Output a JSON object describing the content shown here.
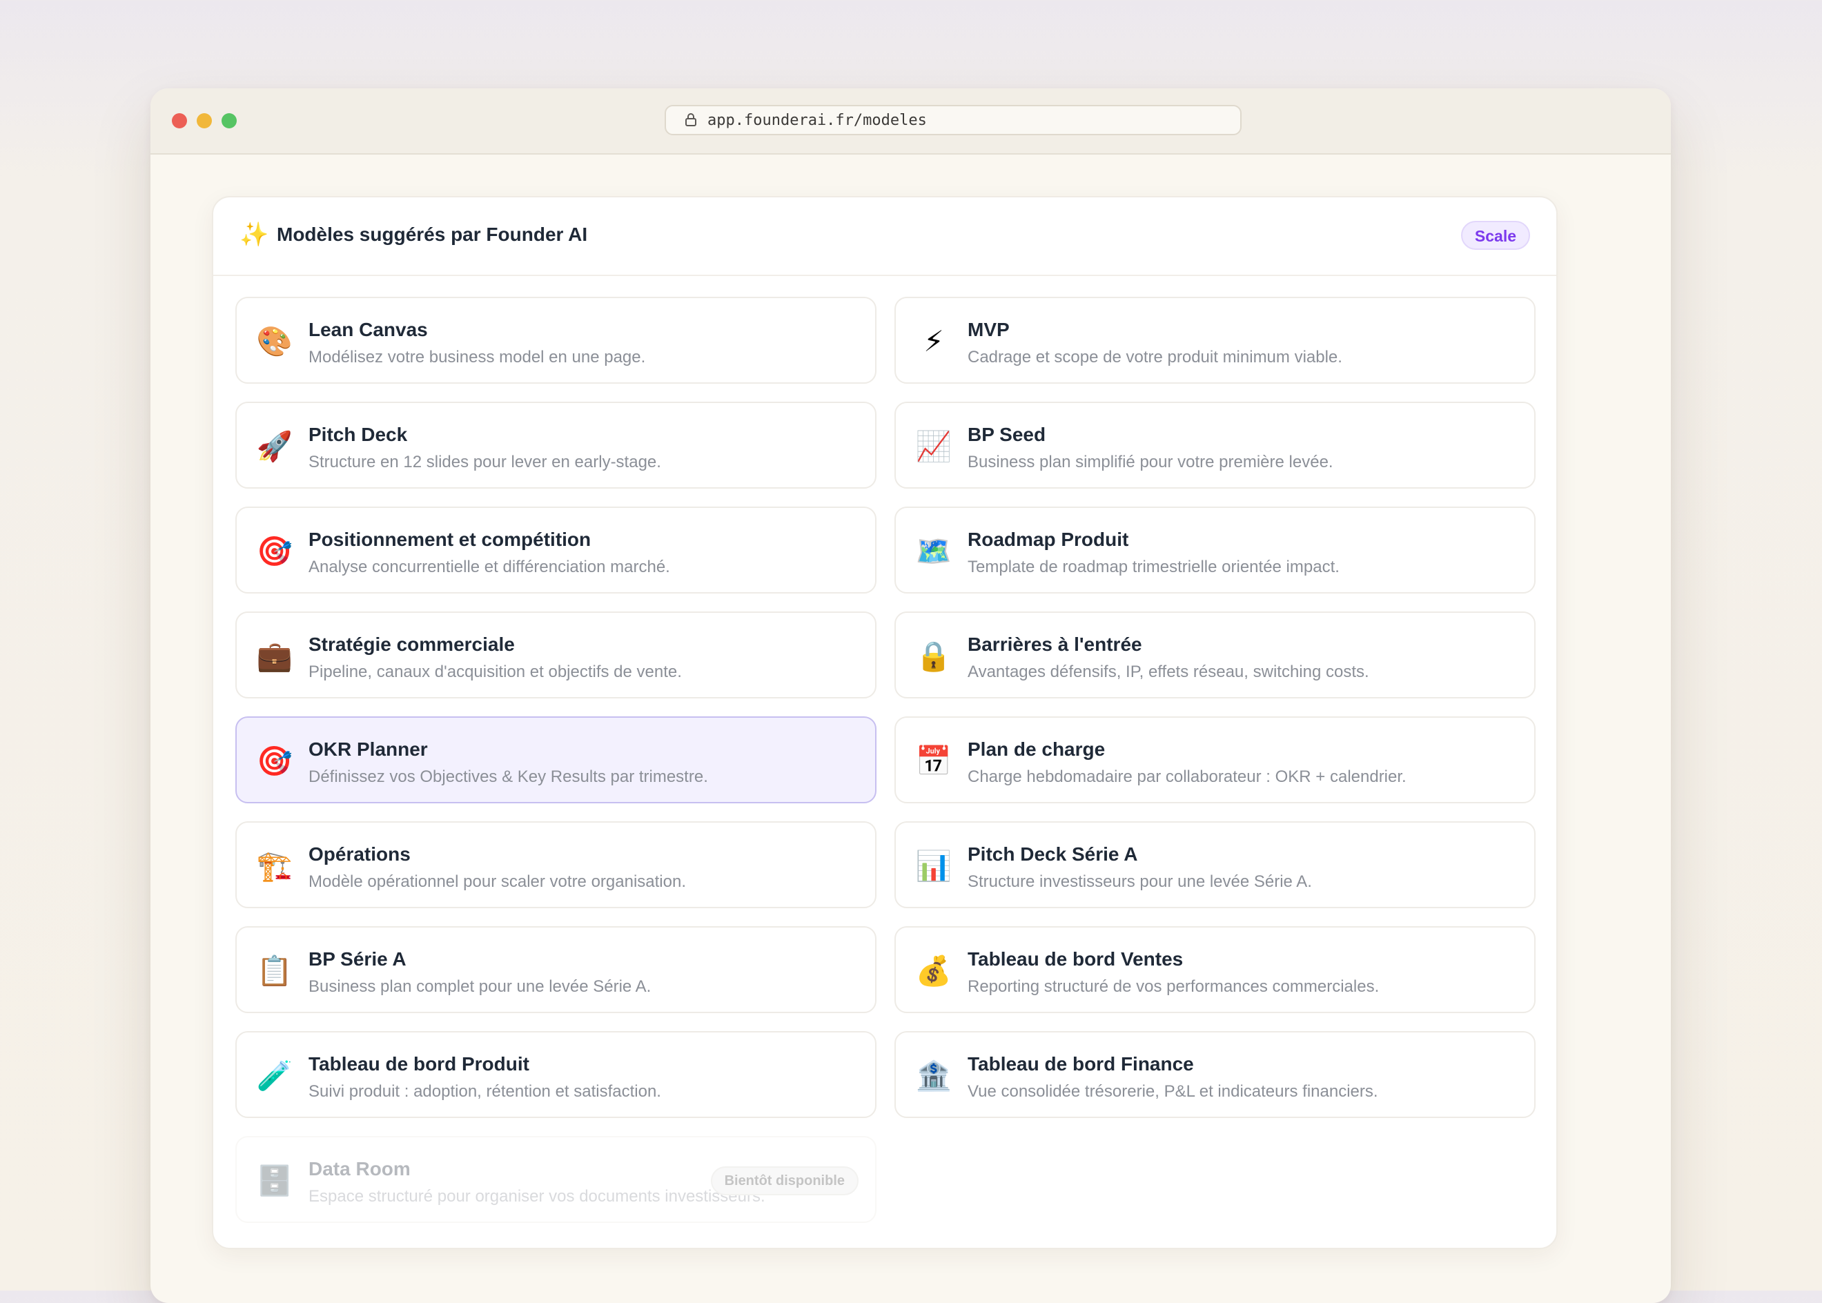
{
  "browser": {
    "url": "app.founderai.fr/modeles"
  },
  "panel": {
    "title": "Modèles suggérés par Founder AI",
    "sparkle": "✨",
    "plan_badge": "Scale"
  },
  "templates": [
    {
      "icon": "🎨",
      "icon_name": "palette-icon",
      "title": "Lean Canvas",
      "desc": "Modélisez votre business model en une page."
    },
    {
      "icon": "⚡",
      "icon_name": "lightning-icon",
      "title": "MVP",
      "desc": "Cadrage et scope de votre produit minimum viable."
    },
    {
      "icon": "🚀",
      "icon_name": "rocket-icon",
      "title": "Pitch Deck",
      "desc": "Structure en 12 slides pour lever en early-stage."
    },
    {
      "icon": "📈",
      "icon_name": "chart-increasing-icon",
      "title": "BP Seed",
      "desc": "Business plan simplifié pour votre première levée."
    },
    {
      "icon": "🎯",
      "icon_name": "target-icon",
      "title": "Positionnement et compétition",
      "desc": "Analyse concurrentielle et différenciation marché."
    },
    {
      "icon": "🗺️",
      "icon_name": "map-icon",
      "title": "Roadmap Produit",
      "desc": "Template de roadmap trimestrielle orientée impact."
    },
    {
      "icon": "💼",
      "icon_name": "briefcase-icon",
      "title": "Stratégie commerciale",
      "desc": "Pipeline, canaux d'acquisition et objectifs de vente."
    },
    {
      "icon": "🔒",
      "icon_name": "lock-icon",
      "title": "Barrières à l'entrée",
      "desc": "Avantages défensifs, IP, effets réseau, switching costs."
    },
    {
      "icon": "🎯",
      "icon_name": "target-icon",
      "title": "OKR Planner",
      "desc": "Définissez vos Objectives & Key Results par trimestre.",
      "active": true
    },
    {
      "icon": "📅",
      "icon_name": "calendar-icon",
      "title": "Plan de charge",
      "desc": "Charge hebdomadaire par collaborateur : OKR + calendrier."
    },
    {
      "icon": "🏗️",
      "icon_name": "crane-icon",
      "title": "Opérations",
      "desc": "Modèle opérationnel pour scaler votre organisation."
    },
    {
      "icon": "📊",
      "icon_name": "bar-chart-icon",
      "title": "Pitch Deck Série A",
      "desc": "Structure investisseurs pour une levée Série A."
    },
    {
      "icon": "📋",
      "icon_name": "clipboard-icon",
      "title": "BP Série A",
      "desc": "Business plan complet pour une levée Série A."
    },
    {
      "icon": "💰",
      "icon_name": "money-bag-icon",
      "title": "Tableau de bord Ventes",
      "desc": "Reporting structuré de vos performances commerciales."
    },
    {
      "icon": "🧪",
      "icon_name": "test-tube-icon",
      "title": "Tableau de bord Produit",
      "desc": "Suivi produit : adoption, rétention et satisfaction."
    },
    {
      "icon": "🏦",
      "icon_name": "bank-icon",
      "title": "Tableau de bord Finance",
      "desc": "Vue consolidée trésorerie, P&L et indicateurs financiers."
    },
    {
      "icon": "🗄️",
      "icon_name": "file-cabinet-icon",
      "title": "Data Room",
      "desc": "Espace structuré pour organiser vos documents investisseurs.",
      "disabled": true,
      "badge": "Bientôt disponible"
    }
  ]
}
